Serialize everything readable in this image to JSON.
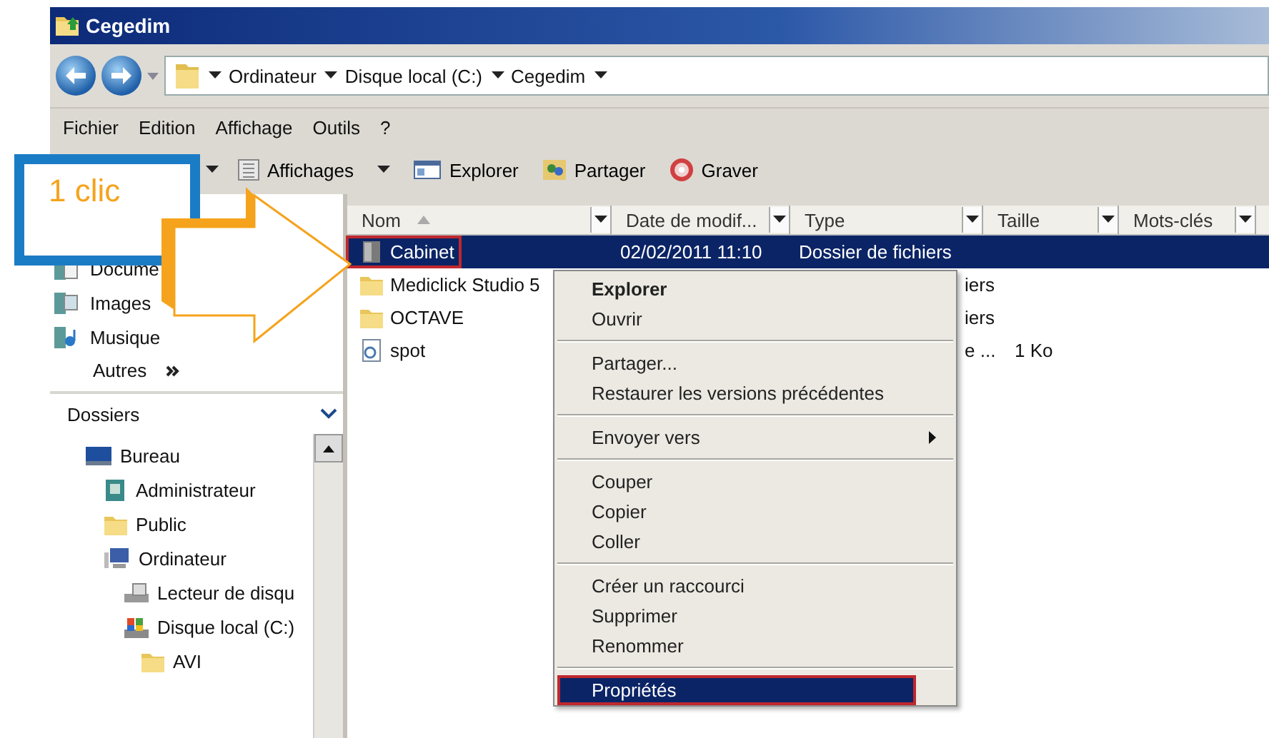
{
  "window": {
    "title": "Cegedim"
  },
  "address": {
    "crumbs": [
      "Ordinateur",
      "Disque local (C:)",
      "Cegedim"
    ]
  },
  "menubar": [
    "Fichier",
    "Edition",
    "Affichage",
    "Outils",
    "?"
  ],
  "toolbar": [
    {
      "label": "Affichages",
      "kind": "views",
      "dropdown": true
    },
    {
      "label": "Explorer",
      "kind": "explore",
      "dropdown": false
    },
    {
      "label": "Partager",
      "kind": "share",
      "dropdown": false
    },
    {
      "label": "Graver",
      "kind": "burn",
      "dropdown": false
    }
  ],
  "columns": [
    "Nom",
    "Date de modif...",
    "Type",
    "Taille",
    "Mots-clés"
  ],
  "files": [
    {
      "name": "Cabinet",
      "date": "02/02/2011 11:10",
      "type": "Dossier de fichiers",
      "kind": "cabinet",
      "selected": true,
      "highlighted": true
    },
    {
      "name": "Mediclick Studio 5",
      "type": "iers",
      "kind": "folder",
      "selected": false,
      "highlighted": false
    },
    {
      "name": "OCTAVE",
      "type": "iers",
      "kind": "folder",
      "selected": false,
      "highlighted": false
    },
    {
      "name": "spot",
      "type": "e ...",
      "size": "1 Ko",
      "kind": "file",
      "selected": false,
      "highlighted": false
    }
  ],
  "favorites": [
    {
      "label": "Docume",
      "kind": "documents"
    },
    {
      "label": "Images",
      "kind": "images"
    },
    {
      "label": "Musique",
      "kind": "music"
    },
    {
      "label": "Autres",
      "kind": "more"
    }
  ],
  "folders": {
    "title": "Dossiers",
    "tree": [
      {
        "label": "Bureau",
        "kind": "desktop",
        "children": [
          {
            "label": "Administrateur",
            "kind": "user"
          },
          {
            "label": "Public",
            "kind": "folder"
          },
          {
            "label": "Ordinateur",
            "kind": "computer",
            "children": [
              {
                "label": "Lecteur de disqu",
                "kind": "drive"
              },
              {
                "label": "Disque local (C:)",
                "kind": "disk",
                "children": [
                  {
                    "label": "AVI",
                    "kind": "folder"
                  }
                ]
              }
            ]
          }
        ]
      }
    ]
  },
  "context_menu": [
    {
      "kind": "item",
      "label": "Explorer",
      "bold": true,
      "submenu": false,
      "selected": false,
      "highlighted": false
    },
    {
      "kind": "item",
      "label": "Ouvrir",
      "bold": false,
      "submenu": false,
      "selected": false,
      "highlighted": false
    },
    {
      "kind": "separator"
    },
    {
      "kind": "item",
      "label": "Partager...",
      "bold": false,
      "submenu": false,
      "selected": false,
      "highlighted": false
    },
    {
      "kind": "item",
      "label": "Restaurer les versions précédentes",
      "bold": false,
      "submenu": false,
      "selected": false,
      "highlighted": false
    },
    {
      "kind": "separator"
    },
    {
      "kind": "item",
      "label": "Envoyer vers",
      "bold": false,
      "submenu": true,
      "selected": false,
      "highlighted": false
    },
    {
      "kind": "separator"
    },
    {
      "kind": "item",
      "label": "Couper",
      "bold": false,
      "submenu": false,
      "selected": false,
      "highlighted": false
    },
    {
      "kind": "item",
      "label": "Copier",
      "bold": false,
      "submenu": false,
      "selected": false,
      "highlighted": false
    },
    {
      "kind": "item",
      "label": "Coller",
      "bold": false,
      "submenu": false,
      "selected": false,
      "highlighted": false
    },
    {
      "kind": "separator"
    },
    {
      "kind": "item",
      "label": "Créer un raccourci",
      "bold": false,
      "submenu": false,
      "selected": false,
      "highlighted": false
    },
    {
      "kind": "item",
      "label": "Supprimer",
      "bold": false,
      "submenu": false,
      "selected": false,
      "highlighted": false
    },
    {
      "kind": "item",
      "label": "Renommer",
      "bold": false,
      "submenu": false,
      "selected": false,
      "highlighted": false
    },
    {
      "kind": "separator"
    },
    {
      "kind": "item",
      "label": "Propriétés",
      "bold": false,
      "submenu": false,
      "selected": true,
      "highlighted": true
    }
  ],
  "callout": {
    "text": "1 clic"
  }
}
